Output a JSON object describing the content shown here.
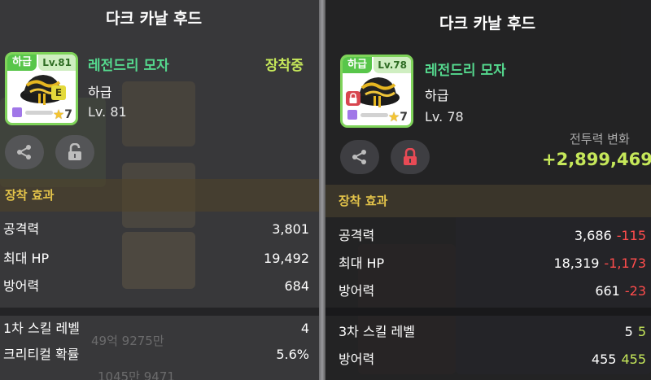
{
  "left_panel": {
    "title": "다크 카날 후드",
    "item": {
      "grade_tag": "하급",
      "level_tag": "Lv.81",
      "enhance_badge": "E",
      "star_count": "7",
      "name": "레전드리 모자",
      "grade": "하급",
      "level": "Lv. 81"
    },
    "equipped_label": "장착중",
    "section_title": "장착 효과",
    "stats": [
      {
        "label": "공격력",
        "value": "3,801"
      },
      {
        "label": "최대 HP",
        "value": "19,492"
      },
      {
        "label": "방어력",
        "value": "684"
      },
      {
        "label": "1차 스킬 레벨",
        "value": "4"
      },
      {
        "label": "크리티컬 확률",
        "value": "5.6%"
      }
    ],
    "background_text": [
      "49억 9275만",
      "1045만 9471"
    ]
  },
  "right_panel": {
    "title": "다크 카날 후드",
    "item": {
      "grade_tag": "하급",
      "level_tag": "Lv.78",
      "star_count": "7",
      "name": "레전드리 모자",
      "grade": "하급",
      "level": "Lv. 78"
    },
    "power_change_label": "전투력 변화",
    "power_change_value": "+2,899,469",
    "section_title": "장착 효과",
    "stats": [
      {
        "label": "공격력",
        "value": "3,686",
        "diff": "-115",
        "diff_type": "neg"
      },
      {
        "label": "최대 HP",
        "value": "18,319",
        "diff": "-1,173",
        "diff_type": "neg"
      },
      {
        "label": "방어력",
        "value": "661",
        "diff": "-23",
        "diff_type": "neg"
      },
      {
        "label": "3차 스킬 레벨",
        "value": "5",
        "diff": "5",
        "diff_type": "pos"
      },
      {
        "label": "방어력",
        "value": "455",
        "diff": "455",
        "diff_type": "pos"
      }
    ]
  },
  "icons": {
    "share": "share-icon",
    "unlock": "unlock-icon",
    "lock": "lock-icon",
    "hat": "hat-icon",
    "star": "star-icon"
  },
  "colors": {
    "item_name": "#55d98e",
    "equipped": "#c6e85a",
    "section_title": "#e4c44a",
    "negative": "#ff4c4c",
    "positive": "#c6e85a",
    "grade_green": "#58c64a",
    "lock_red": "#d8464f"
  }
}
